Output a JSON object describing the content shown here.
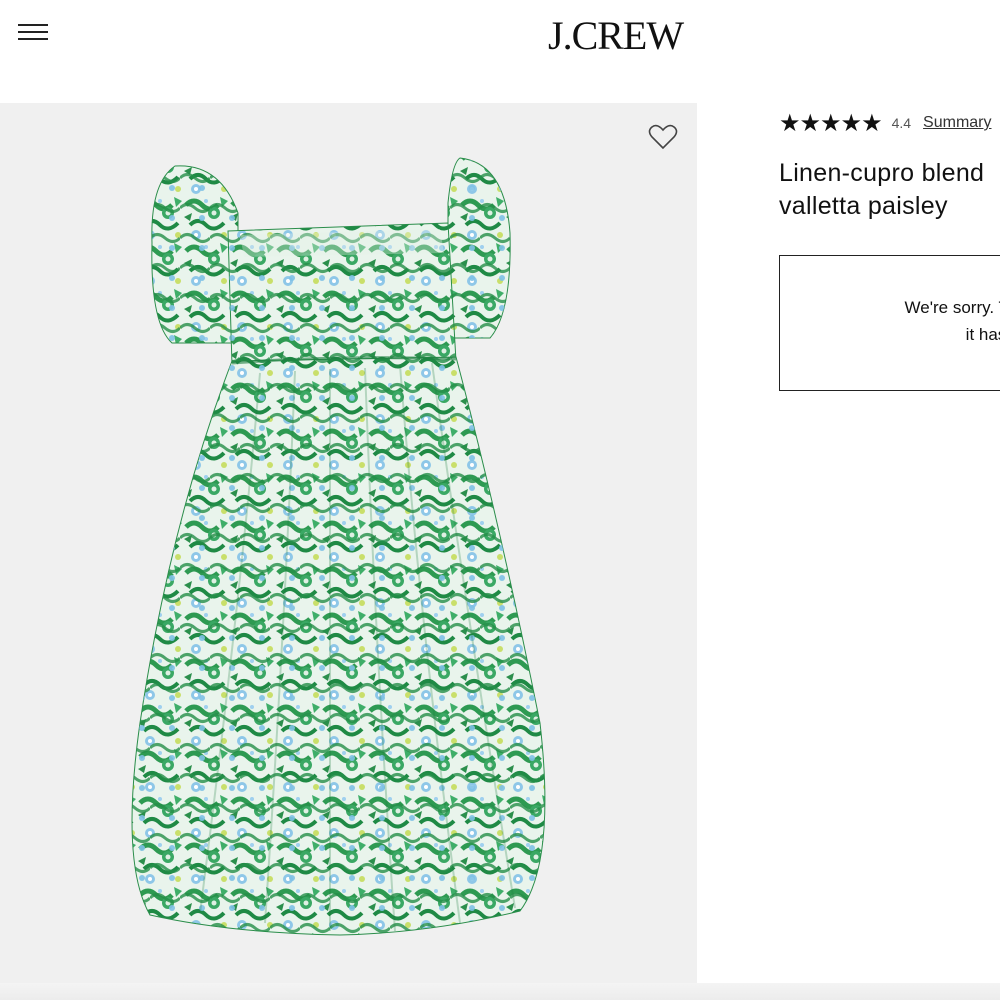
{
  "header": {
    "menu_icon": "hamburger-menu-icon",
    "logo_text": "J.CREW"
  },
  "gallery": {
    "favorite_icon": "heart-outline-icon",
    "product_image": "green floral print puff-sleeve square-neck dress"
  },
  "product": {
    "rating": {
      "stars_value": 4.4,
      "stars_glyph": "★★★★★",
      "value_text": "4.4",
      "summary_label": "Summary"
    },
    "title_line1": "Linen-cupro blend",
    "title_line2": "valletta paisley",
    "notice_line1": "We're sorry. This item",
    "notice_line2": "it has"
  },
  "colors": {
    "dress_green": "#2f9a55",
    "dress_light": "#e8f3ea",
    "gallery_bg": "#f0f0f0"
  }
}
